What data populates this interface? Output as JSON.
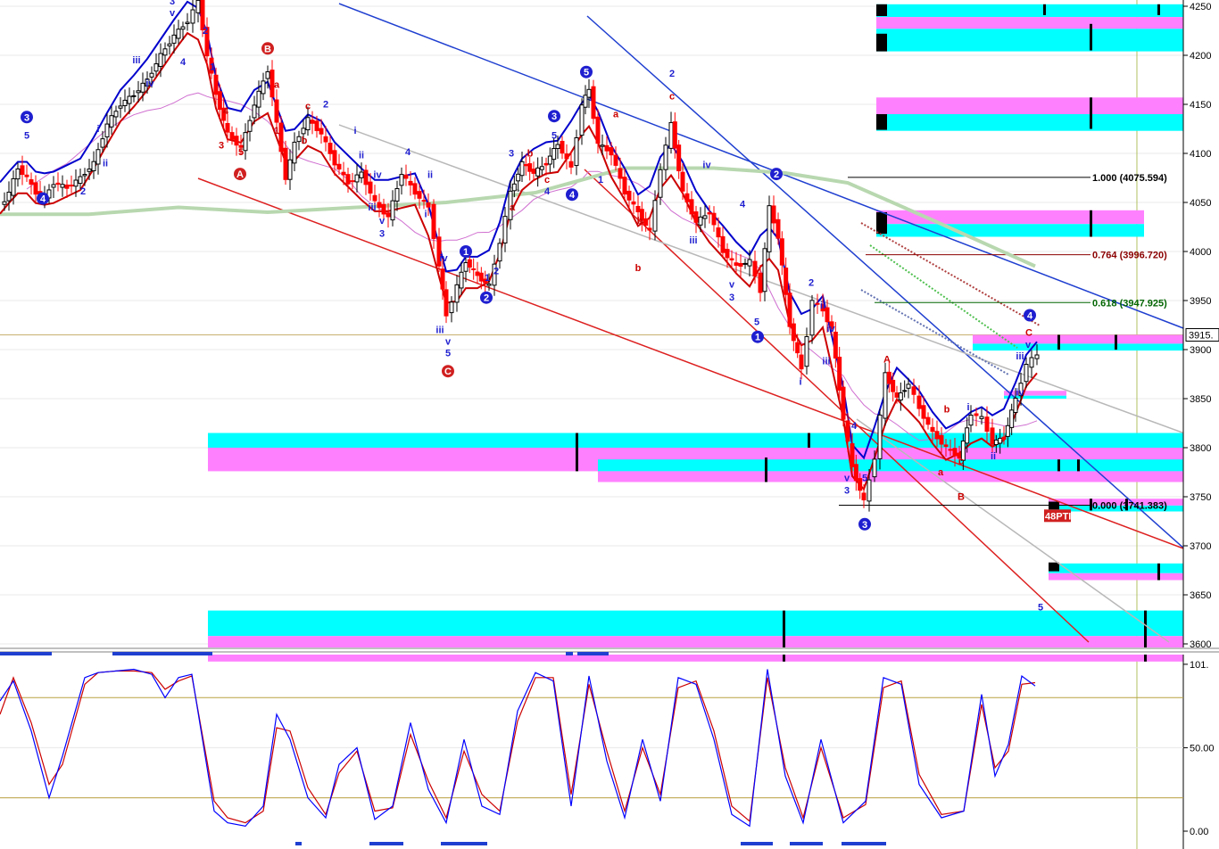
{
  "chart_data": [
    {
      "type": "candlestick",
      "panel": "price",
      "ylim": [
        3580,
        4260
      ],
      "y_ticks": [
        3600,
        3650,
        3700,
        3750,
        3800,
        3850,
        3900,
        3950,
        4000,
        4050,
        4100,
        4150,
        4200,
        4250
      ],
      "y_tick_labels": [
        "3600",
        "3650",
        "3700",
        "3750",
        "3800",
        "3850",
        "3900",
        "3950",
        "4000",
        "4050",
        "4100",
        "4150",
        "4200",
        "4250"
      ],
      "last_price_label": "3915.",
      "grid": true,
      "price_path": [
        [
          0,
          4045
        ],
        [
          10,
          4060
        ],
        [
          20,
          4085
        ],
        [
          30,
          4075
        ],
        [
          40,
          4060
        ],
        [
          50,
          4055
        ],
        [
          60,
          4070
        ],
        [
          75,
          4065
        ],
        [
          90,
          4075
        ],
        [
          105,
          4090
        ],
        [
          120,
          4130
        ],
        [
          135,
          4150
        ],
        [
          150,
          4160
        ],
        [
          165,
          4175
        ],
        [
          180,
          4200
        ],
        [
          195,
          4220
        ],
        [
          210,
          4235
        ],
        [
          222,
          4255
        ],
        [
          232,
          4200
        ],
        [
          242,
          4160
        ],
        [
          255,
          4120
        ],
        [
          270,
          4105
        ],
        [
          285,
          4150
        ],
        [
          300,
          4185
        ],
        [
          310,
          4130
        ],
        [
          320,
          4075
        ],
        [
          330,
          4110
        ],
        [
          345,
          4135
        ],
        [
          360,
          4120
        ],
        [
          375,
          4090
        ],
        [
          390,
          4070
        ],
        [
          405,
          4080
        ],
        [
          420,
          4050
        ],
        [
          435,
          4035
        ],
        [
          450,
          4080
        ],
        [
          465,
          4060
        ],
        [
          480,
          4045
        ],
        [
          492,
          3985
        ],
        [
          500,
          3935
        ],
        [
          512,
          3965
        ],
        [
          522,
          3990
        ],
        [
          535,
          3975
        ],
        [
          548,
          3965
        ],
        [
          560,
          4010
        ],
        [
          572,
          4060
        ],
        [
          585,
          4090
        ],
        [
          598,
          4080
        ],
        [
          612,
          4090
        ],
        [
          625,
          4110
        ],
        [
          640,
          4085
        ],
        [
          652,
          4150
        ],
        [
          660,
          4165
        ],
        [
          670,
          4110
        ],
        [
          685,
          4100
        ],
        [
          700,
          4060
        ],
        [
          715,
          4040
        ],
        [
          728,
          4020
        ],
        [
          740,
          4085
        ],
        [
          752,
          4130
        ],
        [
          765,
          4060
        ],
        [
          780,
          4030
        ],
        [
          795,
          4040
        ],
        [
          810,
          4000
        ],
        [
          825,
          3985
        ],
        [
          840,
          3990
        ],
        [
          852,
          3960
        ],
        [
          862,
          4045
        ],
        [
          872,
          4015
        ],
        [
          885,
          3925
        ],
        [
          898,
          3880
        ],
        [
          910,
          3950
        ],
        [
          922,
          3940
        ],
        [
          932,
          3920
        ],
        [
          945,
          3830
        ],
        [
          955,
          3780
        ],
        [
          968,
          3745
        ],
        [
          980,
          3790
        ],
        [
          992,
          3875
        ],
        [
          1005,
          3850
        ],
        [
          1018,
          3865
        ],
        [
          1030,
          3840
        ],
        [
          1045,
          3815
        ],
        [
          1060,
          3800
        ],
        [
          1075,
          3790
        ],
        [
          1088,
          3835
        ],
        [
          1100,
          3830
        ],
        [
          1112,
          3805
        ],
        [
          1125,
          3810
        ],
        [
          1138,
          3850
        ],
        [
          1150,
          3885
        ],
        [
          1162,
          3895
        ]
      ],
      "wave_labels": [
        {
          "t": "3",
          "x": 193,
          "p": 4252,
          "c": "blue"
        },
        {
          "t": "v",
          "x": 193,
          "p": 4240,
          "c": "blue"
        },
        {
          "t": "4",
          "x": 205,
          "p": 4190,
          "c": "blue"
        },
        {
          "t": "1",
          "x": 238,
          "p": 4185,
          "c": "blue"
        },
        {
          "t": "2",
          "x": 230,
          "p": 4222,
          "c": "blue"
        },
        {
          "t": "iii",
          "x": 153,
          "p": 4192,
          "c": "blue"
        },
        {
          "t": "i",
          "x": 110,
          "p": 4122,
          "c": "blue"
        },
        {
          "t": "ii",
          "x": 118,
          "p": 4087,
          "c": "blue"
        },
        {
          "t": "5",
          "x": 30,
          "p": 4115,
          "c": "blue"
        },
        {
          "t": "2",
          "x": 93,
          "p": 4058,
          "c": "blue"
        },
        {
          "t": "iv",
          "x": 168,
          "p": 4168,
          "c": "blue"
        },
        {
          "t": "4",
          "x": 253,
          "p": 4140,
          "c": "red"
        },
        {
          "t": "3",
          "x": 248,
          "p": 4105,
          "c": "red"
        },
        {
          "t": "5",
          "x": 270,
          "p": 4098,
          "c": "red"
        },
        {
          "t": "a",
          "x": 310,
          "p": 4167,
          "c": "red"
        },
        {
          "t": "c",
          "x": 345,
          "p": 4145,
          "c": "red"
        },
        {
          "t": "b",
          "x": 341,
          "p": 4110,
          "c": "red"
        },
        {
          "t": "1",
          "x": 310,
          "p": 4120,
          "c": "red"
        },
        {
          "t": "2",
          "x": 365,
          "p": 4147,
          "c": "blue"
        },
        {
          "t": "i",
          "x": 398,
          "p": 4120,
          "c": "blue"
        },
        {
          "t": "ii",
          "x": 405,
          "p": 4095,
          "c": "blue"
        },
        {
          "t": "iv",
          "x": 423,
          "p": 4075,
          "c": "blue"
        },
        {
          "t": "iii",
          "x": 417,
          "p": 4042,
          "c": "blue"
        },
        {
          "t": "v",
          "x": 428,
          "p": 4028,
          "c": "blue"
        },
        {
          "t": "3",
          "x": 428,
          "p": 4015,
          "c": "blue"
        },
        {
          "t": "4",
          "x": 457,
          "p": 4098,
          "c": "blue"
        },
        {
          "t": "ii",
          "x": 482,
          "p": 4075,
          "c": "blue"
        },
        {
          "t": "i",
          "x": 477,
          "p": 4035,
          "c": "blue"
        },
        {
          "t": "iv",
          "x": 497,
          "p": 3990,
          "c": "blue"
        },
        {
          "t": "iii",
          "x": 493,
          "p": 3917,
          "c": "blue"
        },
        {
          "t": "v",
          "x": 502,
          "p": 3905,
          "c": "blue"
        },
        {
          "t": "5",
          "x": 502,
          "p": 3893,
          "c": "blue"
        },
        {
          "t": "2",
          "x": 556,
          "p": 3977,
          "c": "blue"
        },
        {
          "t": "1",
          "x": 546,
          "p": 3970,
          "c": "blue"
        },
        {
          "t": "3",
          "x": 573,
          "p": 4097,
          "c": "blue"
        },
        {
          "t": "a",
          "x": 574,
          "p": 4042,
          "c": "red"
        },
        {
          "t": "b",
          "x": 594,
          "p": 4097,
          "c": "red"
        },
        {
          "t": "c",
          "x": 613,
          "p": 4070,
          "c": "red"
        },
        {
          "t": "4",
          "x": 613,
          "p": 4058,
          "c": "blue"
        },
        {
          "t": "5",
          "x": 621,
          "p": 4115,
          "c": "blue"
        },
        {
          "t": "1",
          "x": 673,
          "p": 4070,
          "c": "blue"
        },
        {
          "t": "a",
          "x": 690,
          "p": 4137,
          "c": "red"
        },
        {
          "t": "2",
          "x": 753,
          "p": 4178,
          "c": "blue"
        },
        {
          "t": "c",
          "x": 753,
          "p": 4155,
          "c": "red"
        },
        {
          "t": "b",
          "x": 717,
          "p": 4028,
          "c": "red"
        },
        {
          "t": "b",
          "x": 715,
          "p": 3980,
          "c": "red"
        },
        {
          "t": "iv",
          "x": 792,
          "p": 4085,
          "c": "blue"
        },
        {
          "t": "iii",
          "x": 777,
          "p": 4008,
          "c": "blue"
        },
        {
          "t": "4",
          "x": 832,
          "p": 4045,
          "c": "blue"
        },
        {
          "t": "v",
          "x": 820,
          "p": 3963,
          "c": "blue"
        },
        {
          "t": "3",
          "x": 820,
          "p": 3950,
          "c": "blue"
        },
        {
          "t": "5",
          "x": 848,
          "p": 3925,
          "c": "blue"
        },
        {
          "t": "2",
          "x": 909,
          "p": 3965,
          "c": "blue"
        },
        {
          "t": "ii",
          "x": 922,
          "p": 3942,
          "c": "blue"
        },
        {
          "t": "iv",
          "x": 931,
          "p": 3918,
          "c": "blue"
        },
        {
          "t": "iii",
          "x": 926,
          "p": 3885,
          "c": "blue"
        },
        {
          "t": "i",
          "x": 897,
          "p": 3864,
          "c": "blue"
        },
        {
          "t": "4",
          "x": 957,
          "p": 3819,
          "c": "blue"
        },
        {
          "t": "v",
          "x": 949,
          "p": 3766,
          "c": "blue"
        },
        {
          "t": "3",
          "x": 949,
          "p": 3753,
          "c": "blue"
        },
        {
          "t": "5",
          "x": 969,
          "p": 3766,
          "c": "blue"
        },
        {
          "t": "A",
          "x": 994,
          "p": 3887,
          "c": "red"
        },
        {
          "t": "b",
          "x": 1061,
          "p": 3836,
          "c": "red"
        },
        {
          "t": "a",
          "x": 1054,
          "p": 3772,
          "c": "red"
        },
        {
          "t": "c",
          "x": 1077,
          "p": 3783,
          "c": "red"
        },
        {
          "t": "B",
          "x": 1077,
          "p": 3747,
          "c": "red"
        },
        {
          "t": "i",
          "x": 1085,
          "p": 3838,
          "c": "blue"
        },
        {
          "t": "ii",
          "x": 1113,
          "p": 3788,
          "c": "blue"
        },
        {
          "t": "iv",
          "x": 1143,
          "p": 3853,
          "c": "blue"
        },
        {
          "t": "iii",
          "x": 1143,
          "p": 3890,
          "c": "blue"
        },
        {
          "t": "v",
          "x": 1152,
          "p": 3902,
          "c": "blue"
        },
        {
          "t": "C",
          "x": 1153,
          "p": 3914,
          "c": "red"
        },
        {
          "t": "5",
          "x": 1166,
          "p": 3634,
          "c": "blue"
        }
      ],
      "circle_labels": [
        {
          "t": "3",
          "x": 30,
          "p": 4137,
          "c": "#1f1fd0"
        },
        {
          "t": "4",
          "x": 48,
          "p": 4054,
          "c": "#1f1fd0"
        },
        {
          "t": "B",
          "x": 300,
          "p": 4207,
          "c": "#d02020"
        },
        {
          "t": "A",
          "x": 269,
          "p": 4079,
          "c": "#d02020"
        },
        {
          "t": "C",
          "x": 502,
          "p": 3878,
          "c": "#d02020"
        },
        {
          "t": "1",
          "x": 522,
          "p": 4000,
          "c": "#1f1fd0"
        },
        {
          "t": "2",
          "x": 545,
          "p": 3953,
          "c": "#1f1fd0"
        },
        {
          "t": "3",
          "x": 621,
          "p": 4138,
          "c": "#1f1fd0"
        },
        {
          "t": "4",
          "x": 641,
          "p": 4058,
          "c": "#1f1fd0"
        },
        {
          "t": "5",
          "x": 657,
          "p": 4183,
          "c": "#1f1fd0"
        },
        {
          "t": "2",
          "x": 870,
          "p": 4079,
          "c": "#1f1fd0"
        },
        {
          "t": "1",
          "x": 849,
          "p": 3913,
          "c": "#1f1fd0"
        },
        {
          "t": "3",
          "x": 969,
          "p": 3722,
          "c": "#1f1fd0"
        },
        {
          "t": "4",
          "x": 1154,
          "p": 3935,
          "c": "#1f1fd0"
        }
      ],
      "fib_levels": [
        {
          "label": "1.000 (4075.594)",
          "value": 4075.594,
          "color": "#000000"
        },
        {
          "label": "0.764 (3996.720)",
          "value": 3996.72,
          "color": "#8b0000"
        },
        {
          "label": "0.618 (3947.925)",
          "value": 3947.925,
          "color": "#006400"
        },
        {
          "label": "0.000 (3741.383)",
          "value": 3741.383,
          "color": "#000000"
        }
      ],
      "pti_label": "48PTI",
      "colors": {
        "cyan": "#00ffff",
        "magenta": "#ff80ff",
        "up_candle": "#000000",
        "down_candle": "#ff0000",
        "ma_blue": "#0000cc",
        "ma_red": "#cc0000",
        "ma_green": "#b8d8b0",
        "ma_purple": "#d070d0",
        "trend_gray": "#b8b8b8"
      }
    },
    {
      "type": "line",
      "panel": "stochastic",
      "ylim": [
        -8,
        108
      ],
      "y_ticks": [
        0,
        50,
        100
      ],
      "y_tick_labels": [
        "0.00",
        "50.00",
        "101."
      ],
      "reference_lines": [
        20,
        80
      ],
      "series": [
        {
          "color": "#0000ff",
          "x": [
            0,
            15,
            35,
            55,
            70,
            95,
            110,
            130,
            150,
            170,
            185,
            200,
            215,
            240,
            255,
            275,
            295,
            310,
            325,
            345,
            365,
            380,
            400,
            420,
            440,
            460,
            480,
            500,
            520,
            540,
            560,
            580,
            600,
            620,
            640,
            660,
            680,
            700,
            720,
            740,
            760,
            780,
            800,
            820,
            840,
            860,
            880,
            900,
            920,
            945,
            970,
            990,
            1010,
            1030,
            1055,
            1080,
            1100,
            1115,
            1130,
            1145,
            1160
          ],
          "values": [
            78,
            90,
            60,
            20,
            45,
            92,
            95,
            96,
            97,
            94,
            80,
            92,
            94,
            12,
            5,
            3,
            15,
            70,
            55,
            20,
            8,
            40,
            50,
            7,
            15,
            65,
            25,
            5,
            55,
            15,
            10,
            72,
            95,
            90,
            15,
            93,
            42,
            8,
            55,
            18,
            92,
            88,
            55,
            10,
            3,
            97,
            33,
            5,
            55,
            5,
            18,
            92,
            88,
            28,
            8,
            12,
            82,
            33,
            52,
            93,
            87
          ]
        },
        {
          "color": "#cc0000",
          "x": [
            0,
            15,
            35,
            55,
            70,
            95,
            110,
            130,
            150,
            170,
            185,
            200,
            215,
            240,
            255,
            275,
            295,
            310,
            325,
            345,
            365,
            380,
            400,
            420,
            440,
            460,
            480,
            500,
            520,
            540,
            560,
            580,
            600,
            620,
            640,
            660,
            680,
            700,
            720,
            740,
            760,
            780,
            800,
            820,
            840,
            860,
            880,
            900,
            920,
            945,
            970,
            990,
            1010,
            1030,
            1055,
            1080,
            1100,
            1115,
            1130,
            1145,
            1160
          ],
          "values": [
            70,
            92,
            65,
            28,
            40,
            88,
            95,
            96,
            96,
            95,
            85,
            90,
            93,
            18,
            8,
            5,
            12,
            62,
            60,
            26,
            10,
            35,
            48,
            12,
            14,
            58,
            30,
            8,
            48,
            22,
            12,
            66,
            92,
            92,
            22,
            88,
            48,
            12,
            50,
            22,
            86,
            90,
            60,
            15,
            6,
            92,
            38,
            8,
            50,
            8,
            16,
            86,
            90,
            34,
            10,
            12,
            76,
            38,
            48,
            88,
            89
          ]
        }
      ]
    }
  ]
}
